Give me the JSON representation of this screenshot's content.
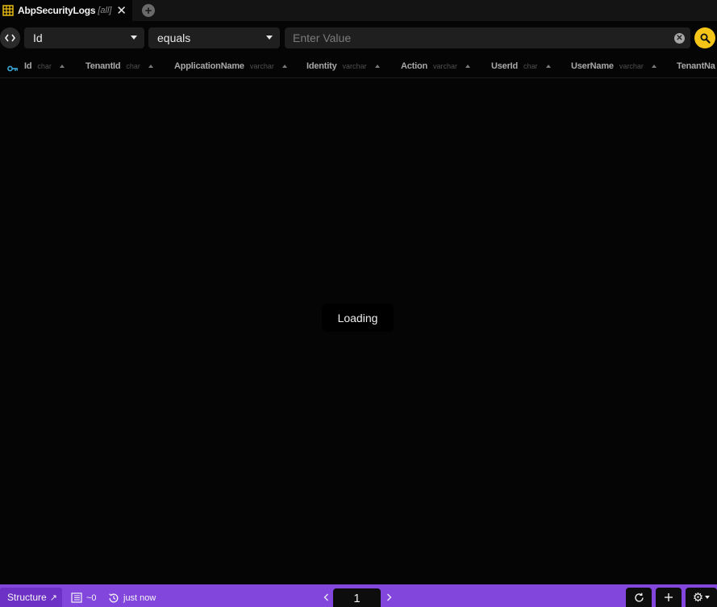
{
  "tab": {
    "title": "AbpSecurityLogs",
    "badge": "[all]",
    "icon": "table-icon",
    "close_icon": "close-icon",
    "add_icon": "plus-circle-icon",
    "accent": "#f5c518"
  },
  "filter": {
    "toggle_icon": "code-brackets-icon",
    "column": "Id",
    "operator": "equals",
    "value_placeholder": "Enter Value",
    "value": "",
    "clear_icon": "clear-icon",
    "search_icon": "search-icon",
    "search_color": "#f5c518"
  },
  "columns": [
    {
      "name": "Id",
      "type": "char",
      "primary_key": true
    },
    {
      "name": "TenantId",
      "type": "char"
    },
    {
      "name": "ApplicationName",
      "type": "varchar"
    },
    {
      "name": "Identity",
      "type": "varchar"
    },
    {
      "name": "Action",
      "type": "varchar"
    },
    {
      "name": "UserId",
      "type": "char"
    },
    {
      "name": "UserName",
      "type": "varchar"
    },
    {
      "name": "TenantNa",
      "type": ""
    }
  ],
  "loading_text": "Loading",
  "statusbar": {
    "color": "#8246dd",
    "structure_label": "Structure",
    "structure_arrow": "↗",
    "row_count": "~0",
    "refreshed": "just now",
    "page": "1",
    "icons": {
      "rows": "rows-icon",
      "history": "history-icon",
      "prev": "chevron-left-icon",
      "next": "chevron-right-icon",
      "refresh": "refresh-icon",
      "add": "add-row-icon",
      "settings": "gear-icon"
    }
  }
}
